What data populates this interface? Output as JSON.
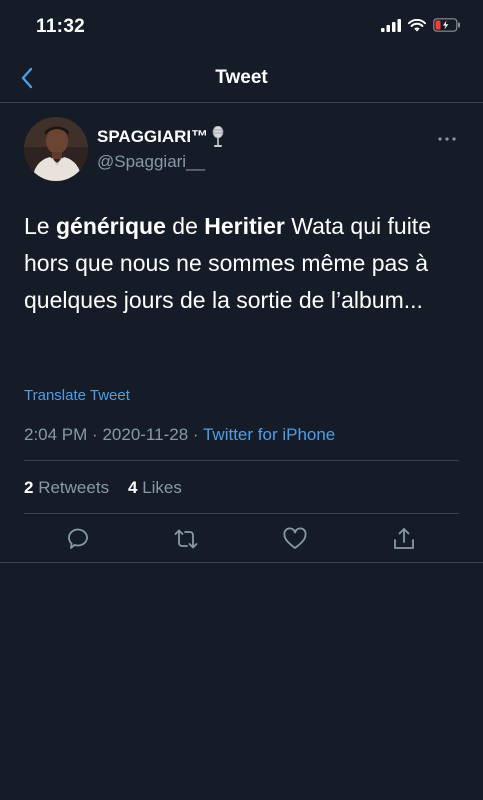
{
  "status_bar": {
    "time": "11:32"
  },
  "nav": {
    "title": "Tweet"
  },
  "tweet": {
    "author_name": "SPAGGIARI™",
    "author_handle": "@Spaggiari__",
    "text_segments": [
      {
        "text": "Le ",
        "bold": false
      },
      {
        "text": "générique",
        "bold": true
      },
      {
        "text": " de ",
        "bold": false
      },
      {
        "text": "Heritier",
        "bold": true
      },
      {
        "text": " Wata qui fuite hors que nous ne sommes même pas à quelques jours de la sortie de l’album...",
        "bold": false
      }
    ],
    "translate_label": "Translate Tweet",
    "time": "2:04 PM",
    "date": "2020-11-28",
    "separator": "·",
    "source": "Twitter for iPhone",
    "retweets_count": "2",
    "retweets_label": "Retweets",
    "likes_count": "4",
    "likes_label": "Likes"
  },
  "icons": {
    "back": "chevron-left-icon",
    "more": "more-icon",
    "reply": "reply-icon",
    "retweet": "retweet-icon",
    "like": "heart-icon",
    "share": "share-icon",
    "name_emoji": "microphone-icon"
  },
  "colors": {
    "background": "#151c28",
    "accent": "#4d9ee6",
    "secondary_text": "#8899a6",
    "divider": "#38444d",
    "battery_low": "#ff3b30"
  }
}
